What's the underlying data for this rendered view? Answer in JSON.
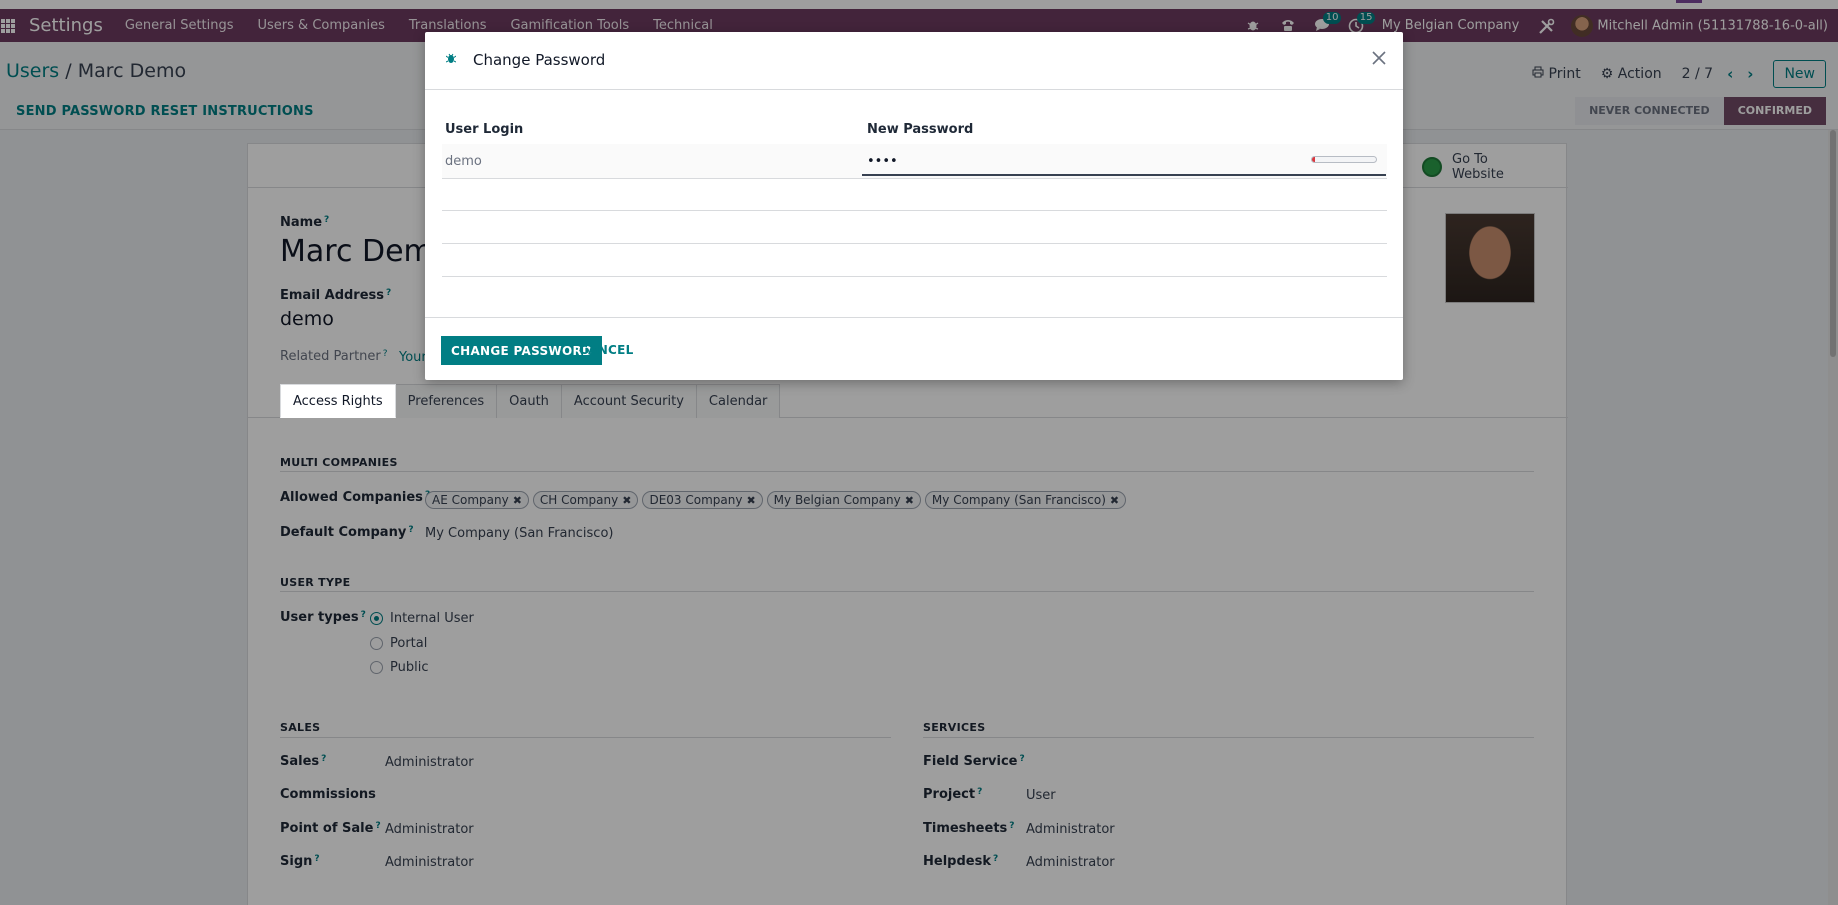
{
  "navbar": {
    "app_name": "Settings",
    "menu": [
      "General Settings",
      "Users & Companies",
      "Translations",
      "Gamification Tools",
      "Technical"
    ],
    "chat_badge": "10",
    "activity_badge": "15",
    "company": "My Belgian Company",
    "user": "Mitchell Admin (51131788-16-0-all)"
  },
  "control_panel": {
    "breadcrumb_root": "Users",
    "breadcrumb_sep": " / ",
    "breadcrumb_current": "Marc Demo",
    "reset_button": "SEND PASSWORD RESET INSTRUCTIONS",
    "print": "Print",
    "action": "Action",
    "pager": "2 / 7",
    "new": "New",
    "stages": [
      "NEVER CONNECTED",
      "CONFIRMED"
    ],
    "active_stage": "CONFIRMED"
  },
  "form": {
    "go_to_website": "Go To Website",
    "name_label": "Name",
    "name_value": "Marc Dem",
    "email_label": "Email Address",
    "email_value": "demo",
    "related_partner_label": "Related Partner",
    "related_partner_value": "Your",
    "tabs": [
      "Access Rights",
      "Preferences",
      "Oauth",
      "Account Security",
      "Calendar"
    ],
    "multi_companies_title": "MULTI COMPANIES",
    "allowed_companies_label": "Allowed Companies",
    "allowed_companies": [
      "AE Company",
      "CH Company",
      "DE03 Company",
      "My Belgian Company",
      "My Company (San Francisco)"
    ],
    "default_company_label": "Default Company",
    "default_company_value": "My Company (San Francisco)",
    "user_type_title": "USER TYPE",
    "user_types_label": "User types",
    "user_type_options": [
      "Internal User",
      "Portal",
      "Public"
    ],
    "user_type_selected": "Internal User",
    "sales_title": "SALES",
    "services_title": "SERVICES",
    "sales_rows": [
      {
        "label": "Sales",
        "value": "Administrator"
      },
      {
        "label": "Commissions",
        "value": ""
      },
      {
        "label": "Point of Sale",
        "value": "Administrator"
      },
      {
        "label": "Sign",
        "value": "Administrator"
      }
    ],
    "services_rows": [
      {
        "label": "Field Service",
        "value": ""
      },
      {
        "label": "Project",
        "value": "User"
      },
      {
        "label": "Timesheets",
        "value": "Administrator"
      },
      {
        "label": "Helpdesk",
        "value": "Administrator"
      }
    ]
  },
  "modal": {
    "title": "Change Password",
    "col_user_login": "User Login",
    "col_new_password": "New Password",
    "user_login": "demo",
    "new_password": "demo",
    "password_strength": 0.05,
    "change_button": "CHANGE PASSWORD",
    "cancel_button": "CANCEL"
  },
  "colors": {
    "brand": "#714b67",
    "primary": "#017e84",
    "strength_weak": "#d9363e"
  }
}
